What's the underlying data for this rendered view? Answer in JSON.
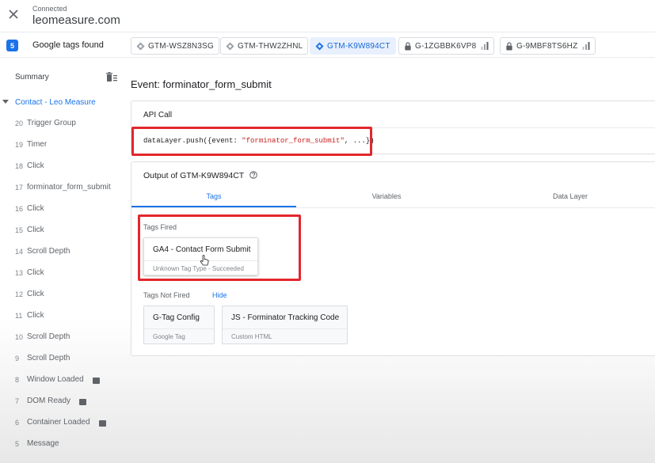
{
  "connection": {
    "status": "Connected",
    "domain": "leomeasure.com"
  },
  "tags_bar": {
    "count": "5",
    "label": "Google tags found",
    "chips": [
      {
        "label": "GTM-WSZ8N3SG",
        "kind": "gtm"
      },
      {
        "label": "GTM-THW2ZHNL",
        "kind": "gtm"
      },
      {
        "label": "GTM-K9W894CT",
        "kind": "gtm",
        "active": true
      },
      {
        "label": "G-1ZGBBK6VP8",
        "kind": "ga"
      },
      {
        "label": "G-9MBF8TS6HZ",
        "kind": "ga"
      }
    ]
  },
  "sidebar": {
    "summary_label": "Summary",
    "group_label": "Contact - Leo Measure",
    "events": [
      {
        "num": "20",
        "name": "Trigger Group"
      },
      {
        "num": "19",
        "name": "Timer"
      },
      {
        "num": "18",
        "name": "Click"
      },
      {
        "num": "17",
        "name": "forminator_form_submit"
      },
      {
        "num": "16",
        "name": "Click"
      },
      {
        "num": "15",
        "name": "Click"
      },
      {
        "num": "14",
        "name": "Scroll Depth"
      },
      {
        "num": "13",
        "name": "Click"
      },
      {
        "num": "12",
        "name": "Click"
      },
      {
        "num": "11",
        "name": "Click"
      },
      {
        "num": "10",
        "name": "Scroll Depth"
      },
      {
        "num": "9",
        "name": "Scroll Depth"
      },
      {
        "num": "8",
        "name": "Window Loaded",
        "badge": true
      },
      {
        "num": "7",
        "name": "DOM Ready",
        "badge": true
      },
      {
        "num": "6",
        "name": "Container Loaded",
        "badge": true
      },
      {
        "num": "5",
        "name": "Message"
      }
    ]
  },
  "event": {
    "title": "Event: forminator_form_submit"
  },
  "api_call": {
    "heading": "API Call",
    "code_prefix": "dataLayer.push({event: ",
    "code_string": "\"forminator_form_submit\"",
    "code_suffix": ", ...})"
  },
  "output": {
    "heading": "Output of GTM-K9W894CT",
    "tabs": [
      "Tags",
      "Variables",
      "Data Layer"
    ],
    "active_tab": "Tags",
    "tags_fired_label": "Tags Fired",
    "tags_fired": [
      {
        "name": "GA4 - Contact Form Submit",
        "sub": "Unknown Tag Type - Succeeded"
      }
    ],
    "tags_not_fired_label": "Tags Not Fired",
    "hide_label": "Hide",
    "tags_not_fired": [
      {
        "name": "G-Tag Config",
        "sub": "Google Tag"
      },
      {
        "name": "JS - Forminator Tracking Code",
        "sub": "Custom HTML"
      }
    ]
  },
  "colors": {
    "accent": "#1a73e8",
    "highlight": "#e3262d"
  }
}
